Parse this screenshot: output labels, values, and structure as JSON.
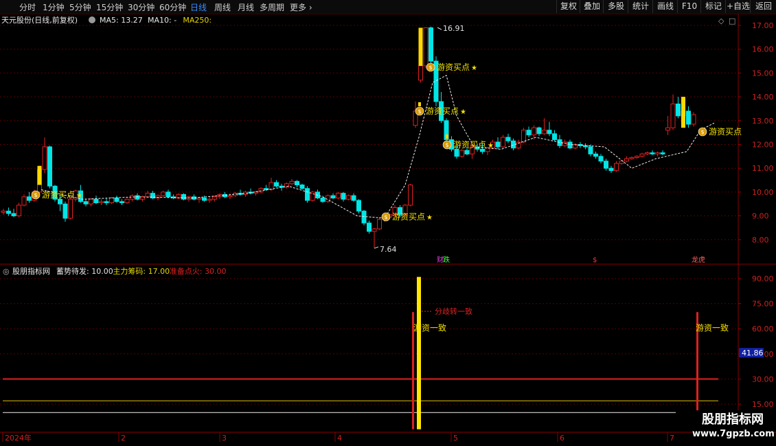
{
  "toolbar": {
    "periods": [
      {
        "label": "分时",
        "active": false
      },
      {
        "label": "1分钟",
        "active": false
      },
      {
        "label": "5分钟",
        "active": false
      },
      {
        "label": "15分钟",
        "active": false
      },
      {
        "label": "30分钟",
        "active": false
      },
      {
        "label": "60分钟",
        "active": false
      },
      {
        "label": "日线",
        "active": true
      },
      {
        "label": "周线",
        "active": false
      },
      {
        "label": "月线",
        "active": false
      },
      {
        "label": "多周期",
        "active": false
      },
      {
        "label": "更多",
        "active": false
      }
    ],
    "right_buttons": [
      "复权",
      "叠加",
      "多股",
      "统计",
      "画线",
      "F10",
      "标记",
      "+自选",
      "返回"
    ]
  },
  "main_chart": {
    "stock_title": "天元股份(日线,前复权)",
    "ma_labels": [
      {
        "text": "MA5: 13.27",
        "color": "#e8e8e8"
      },
      {
        "text": "MA10: -",
        "color": "#e8e8e8"
      },
      {
        "text": "MA250:",
        "color": "#e8d800"
      }
    ],
    "y_ticks": [
      "17.00",
      "16.00",
      "15.00",
      "14.00",
      "13.00",
      "12.00",
      "11.00",
      "10.00",
      "9.00",
      "8.00"
    ],
    "high_label": "16.91",
    "low_label": "7.64",
    "buy_signal_text": "游资买点",
    "star": "★",
    "bottom_markers": [
      {
        "text": "财",
        "color": "#e040e0"
      },
      {
        "text": "跌",
        "color": "#3cff3c"
      },
      {
        "text": "$",
        "color": "#ff3030"
      },
      {
        "text": "龙虎",
        "color": "#ff6060"
      }
    ]
  },
  "indicator": {
    "name": "股朋指标网",
    "params": [
      {
        "text": "蓄势待发: 10.00",
        "color": "#e8e8e8"
      },
      {
        "text": "主力筹码: 17.00",
        "color": "#e8d800"
      },
      {
        "text": "准备点火: 30.00",
        "color": "#e02020"
      }
    ],
    "y_ticks": [
      "90.00",
      "75.00",
      "60.00",
      "45.00",
      "30.00",
      "15.00"
    ],
    "current_value": "41.86",
    "annot_diverge": "分歧转一致",
    "annot_consensus": "游资一致"
  },
  "x_axis": {
    "labels": [
      "2024年",
      "2",
      "3",
      "4",
      "5",
      "6",
      "7"
    ]
  },
  "watermark": {
    "main": "股朋指标网",
    "url": "www.7gpzb.com"
  },
  "chart_data": {
    "type": "candlestick",
    "ylim": [
      7.5,
      17.2
    ],
    "bars": [
      [
        9.15,
        9.3,
        9.05,
        9.2
      ],
      [
        9.2,
        9.35,
        9.0,
        9.1
      ],
      [
        9.1,
        9.3,
        8.95,
        9.0
      ],
      [
        9.0,
        9.55,
        8.95,
        9.45
      ],
      [
        9.45,
        9.9,
        9.4,
        9.8
      ],
      [
        9.8,
        10.0,
        9.55,
        9.65
      ],
      [
        9.65,
        10.1,
        9.6,
        10.0
      ],
      [
        10.0,
        11.1,
        9.95,
        10.95
      ],
      [
        10.95,
        12.3,
        10.8,
        11.9
      ],
      [
        11.9,
        11.95,
        10.15,
        10.25
      ],
      [
        10.25,
        10.3,
        9.6,
        9.7
      ],
      [
        9.7,
        9.85,
        9.2,
        9.5
      ],
      [
        9.5,
        9.6,
        8.75,
        8.9
      ],
      [
        8.9,
        9.8,
        8.85,
        9.7
      ],
      [
        9.7,
        10.1,
        9.6,
        10.05
      ],
      [
        10.05,
        10.3,
        9.55,
        9.6
      ],
      [
        9.6,
        9.7,
        9.4,
        9.5
      ],
      [
        9.5,
        9.75,
        9.4,
        9.7
      ],
      [
        9.7,
        9.85,
        9.5,
        9.55
      ],
      [
        9.55,
        9.7,
        9.45,
        9.6
      ],
      [
        9.6,
        9.75,
        9.45,
        9.55
      ],
      [
        9.55,
        9.8,
        9.5,
        9.75
      ],
      [
        9.75,
        9.85,
        9.55,
        9.6
      ],
      [
        9.6,
        9.7,
        9.45,
        9.55
      ],
      [
        9.55,
        9.75,
        9.5,
        9.7
      ],
      [
        9.7,
        9.9,
        9.6,
        9.85
      ],
      [
        9.85,
        9.95,
        9.65,
        9.7
      ],
      [
        9.7,
        9.85,
        9.6,
        9.8
      ],
      [
        9.8,
        10.05,
        9.75,
        9.95
      ],
      [
        9.95,
        10.05,
        9.7,
        9.75
      ],
      [
        9.75,
        9.9,
        9.65,
        9.85
      ],
      [
        9.85,
        10.05,
        9.8,
        10.0
      ],
      [
        10.0,
        10.1,
        9.75,
        9.8
      ],
      [
        9.8,
        9.9,
        9.7,
        9.75
      ],
      [
        9.75,
        9.95,
        9.7,
        9.9
      ],
      [
        9.9,
        9.95,
        9.65,
        9.7
      ],
      [
        9.7,
        9.85,
        9.6,
        9.8
      ],
      [
        9.8,
        9.9,
        9.65,
        9.7
      ],
      [
        9.7,
        9.8,
        9.55,
        9.75
      ],
      [
        9.75,
        9.85,
        9.6,
        9.65
      ],
      [
        9.65,
        9.8,
        9.55,
        9.7
      ],
      [
        9.7,
        9.85,
        9.6,
        9.8
      ],
      [
        9.8,
        9.95,
        9.7,
        9.9
      ],
      [
        9.9,
        10.0,
        9.75,
        9.8
      ],
      [
        9.8,
        9.95,
        9.7,
        9.85
      ],
      [
        9.85,
        10.0,
        9.8,
        9.95
      ],
      [
        9.95,
        10.1,
        9.85,
        9.9
      ],
      [
        9.9,
        10.05,
        9.8,
        10.0
      ],
      [
        10.0,
        10.15,
        9.9,
        9.95
      ],
      [
        9.95,
        10.05,
        9.85,
        10.0
      ],
      [
        10.0,
        10.2,
        9.95,
        10.15
      ],
      [
        10.15,
        10.3,
        10.05,
        10.1
      ],
      [
        10.1,
        10.6,
        10.05,
        10.4
      ],
      [
        10.4,
        10.5,
        10.2,
        10.25
      ],
      [
        10.25,
        10.35,
        10.05,
        10.2
      ],
      [
        10.2,
        10.4,
        10.15,
        10.35
      ],
      [
        10.35,
        10.55,
        10.3,
        10.45
      ],
      [
        10.45,
        10.5,
        10.2,
        10.3
      ],
      [
        10.3,
        10.35,
        10.1,
        10.15
      ],
      [
        10.15,
        10.25,
        9.55,
        9.65
      ],
      [
        9.65,
        10.05,
        9.6,
        10.0
      ],
      [
        10.0,
        10.1,
        9.7,
        9.75
      ],
      [
        9.75,
        9.85,
        9.55,
        9.6
      ],
      [
        9.6,
        9.9,
        9.55,
        9.85
      ],
      [
        9.85,
        9.95,
        9.7,
        9.75
      ],
      [
        9.75,
        10.0,
        9.7,
        9.95
      ],
      [
        9.95,
        10.0,
        9.6,
        9.7
      ],
      [
        9.7,
        9.9,
        9.65,
        9.85
      ],
      [
        9.85,
        9.95,
        9.6,
        9.65
      ],
      [
        9.65,
        9.7,
        9.1,
        9.2
      ],
      [
        9.2,
        9.25,
        8.6,
        8.7
      ],
      [
        8.7,
        8.8,
        8.25,
        8.35
      ],
      [
        8.35,
        8.5,
        7.64,
        8.45
      ],
      [
        8.45,
        8.95,
        8.4,
        8.85
      ],
      [
        8.85,
        9.0,
        8.75,
        8.95
      ],
      [
        8.95,
        9.1,
        8.85,
        9.05
      ],
      [
        9.05,
        9.45,
        8.95,
        9.35
      ],
      [
        9.35,
        9.45,
        8.95,
        9.05
      ],
      [
        9.05,
        9.5,
        9.0,
        9.45
      ],
      [
        9.45,
        10.35,
        9.4,
        10.3
      ],
      [
        12.8,
        13.8,
        12.7,
        13.4
      ],
      [
        14.7,
        15.5,
        14.6,
        15.3
      ],
      [
        15.3,
        16.91,
        15.2,
        16.9
      ],
      [
        16.9,
        16.95,
        15.3,
        15.5
      ],
      [
        15.5,
        15.7,
        13.6,
        13.8
      ],
      [
        13.8,
        14.2,
        12.9,
        13.0
      ],
      [
        13.0,
        13.1,
        12.0,
        12.2
      ],
      [
        12.2,
        12.35,
        11.7,
        11.8
      ],
      [
        11.8,
        11.95,
        11.4,
        11.5
      ],
      [
        11.5,
        11.8,
        11.45,
        11.75
      ],
      [
        11.75,
        11.85,
        11.55,
        11.6
      ],
      [
        11.6,
        12.0,
        11.4,
        11.9
      ],
      [
        11.9,
        12.05,
        11.7,
        11.8
      ],
      [
        11.8,
        12.05,
        11.6,
        11.7
      ],
      [
        11.7,
        11.9,
        11.55,
        11.85
      ],
      [
        11.85,
        12.2,
        11.8,
        12.1
      ],
      [
        12.1,
        12.3,
        11.8,
        11.9
      ],
      [
        11.9,
        12.4,
        11.85,
        12.3
      ],
      [
        12.3,
        12.45,
        12.05,
        12.15
      ],
      [
        12.15,
        12.25,
        11.75,
        11.85
      ],
      [
        11.85,
        12.2,
        11.8,
        12.1
      ],
      [
        12.1,
        12.7,
        12.05,
        12.6
      ],
      [
        12.6,
        12.75,
        12.3,
        12.4
      ],
      [
        12.4,
        12.8,
        12.2,
        12.7
      ],
      [
        12.7,
        12.75,
        12.35,
        12.45
      ],
      [
        12.45,
        13.1,
        12.4,
        12.6
      ],
      [
        12.6,
        12.95,
        12.35,
        12.45
      ],
      [
        12.45,
        12.6,
        12.15,
        12.2
      ],
      [
        12.2,
        12.4,
        11.85,
        11.95
      ],
      [
        11.95,
        12.2,
        11.9,
        12.1
      ],
      [
        12.1,
        12.2,
        11.8,
        11.85
      ],
      [
        11.85,
        12.05,
        11.8,
        12.0
      ],
      [
        12.0,
        12.1,
        11.85,
        11.95
      ],
      [
        11.95,
        12.05,
        11.8,
        11.9
      ],
      [
        11.9,
        12.0,
        11.5,
        11.6
      ],
      [
        11.6,
        11.7,
        11.4,
        11.5
      ],
      [
        11.5,
        11.6,
        11.2,
        11.3
      ],
      [
        11.3,
        11.4,
        10.9,
        11.0
      ],
      [
        11.0,
        11.1,
        10.8,
        10.9
      ],
      [
        10.9,
        11.3,
        10.85,
        11.2
      ],
      [
        11.2,
        11.35,
        11.15,
        11.3
      ],
      [
        11.3,
        11.5,
        11.25,
        11.4
      ],
      [
        11.4,
        11.5,
        11.35,
        11.45
      ],
      [
        11.45,
        11.55,
        11.4,
        11.5
      ],
      [
        11.5,
        11.65,
        11.45,
        11.6
      ],
      [
        11.6,
        11.7,
        11.55,
        11.65
      ],
      [
        11.65,
        11.75,
        11.55,
        11.6
      ],
      [
        11.6,
        11.7,
        11.5,
        11.65
      ],
      [
        11.65,
        11.75,
        11.55,
        11.6
      ],
      [
        12.6,
        13.2,
        12.4,
        12.7
      ],
      [
        12.7,
        14.1,
        12.6,
        13.7
      ],
      [
        13.7,
        14.0,
        13.1,
        13.2
      ],
      [
        13.2,
        13.55,
        12.9,
        13.4
      ],
      [
        13.4,
        13.6,
        12.7,
        12.85
      ],
      [
        12.85,
        13.35,
        12.75,
        13.25
      ]
    ]
  }
}
